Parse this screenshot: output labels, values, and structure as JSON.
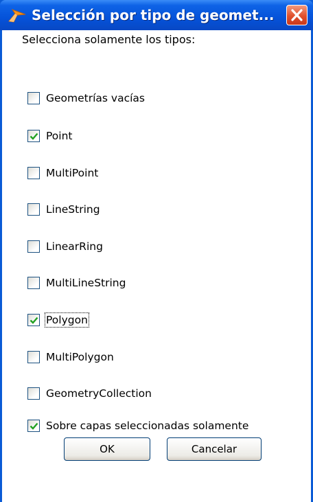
{
  "window": {
    "title": "Selección por tipo de geomet...",
    "icon": "orange-arrow-app-icon",
    "close_icon": "close-icon",
    "colors": {
      "titlebar": "#0552d9",
      "close": "#e0502c",
      "check": "#21a121"
    }
  },
  "dialog": {
    "prompt": "Selecciona solamente los tipos:",
    "options": [
      {
        "label": "Geometrías vacías",
        "checked": false
      },
      {
        "label": "Point",
        "checked": true
      },
      {
        "label": "MultiPoint",
        "checked": false
      },
      {
        "label": "LineString",
        "checked": false
      },
      {
        "label": "LinearRing",
        "checked": false
      },
      {
        "label": "MultiLineString",
        "checked": false
      },
      {
        "label": "Polygon",
        "checked": true
      },
      {
        "label": "MultiPolygon",
        "checked": false
      },
      {
        "label": "GeometryCollection",
        "checked": false
      },
      {
        "label": "Sobre capas seleccionadas solamente",
        "checked": true
      }
    ],
    "ok_label": "OK",
    "cancel_label": "Cancelar"
  }
}
